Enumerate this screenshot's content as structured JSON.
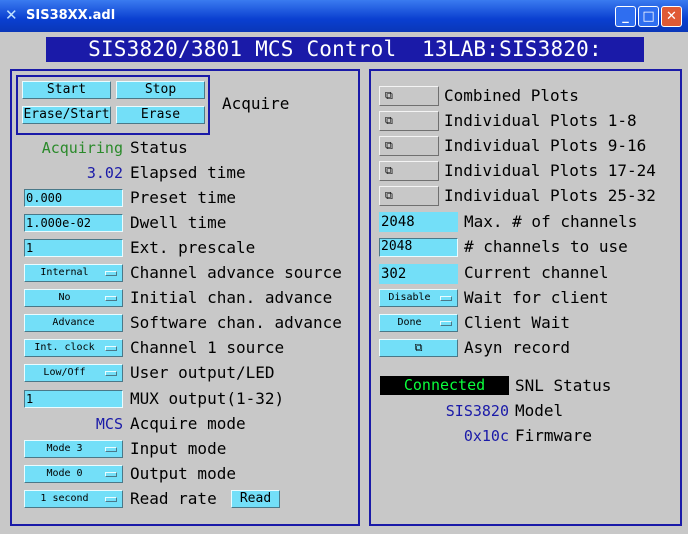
{
  "window": {
    "title": "SIS38XX.adl",
    "icon": "x-tool-icon",
    "btn_min": "_",
    "btn_max": "□",
    "btn_close": "✕"
  },
  "banner": "SIS3820/3801 MCS Control  13LAB:SIS3820:",
  "acquire": {
    "start": "Start",
    "stop": "Stop",
    "erase_start": "Erase/Start",
    "erase": "Erase",
    "label": "Acquire"
  },
  "left": {
    "status_value": "Acquiring",
    "status_color": "#2a8a2a",
    "status_label": "Status",
    "elapsed_value": "3.02",
    "elapsed_label": "Elapsed time",
    "preset_value": "0.000",
    "preset_label": "Preset time",
    "dwell_value": "1.000e-02",
    "dwell_label": "Dwell time",
    "prescale_value": "1",
    "prescale_label": "Ext. prescale",
    "chan_adv_src": "Internal",
    "chan_adv_src_label": "Channel advance source",
    "init_adv": "No",
    "init_adv_label": "Initial chan. advance",
    "soft_adv": "Advance",
    "soft_adv_label": "Software chan. advance",
    "ch1_src": "Int. clock",
    "ch1_src_label": "Channel 1 source",
    "user_out": "Low/Off",
    "user_out_label": "User output/LED",
    "mux_value": "1",
    "mux_label": "MUX output(1-32)",
    "acq_mode_value": "MCS",
    "acq_mode_label": "Acquire mode",
    "input_mode": "Mode 3",
    "input_mode_label": "Input mode",
    "output_mode": "Mode 0",
    "output_mode_label": "Output mode",
    "read_rate": "1 second",
    "read_rate_label": "Read rate",
    "read_btn": "Read"
  },
  "right": {
    "plots": [
      "Combined Plots",
      "Individual Plots 1-8",
      "Individual Plots 9-16",
      "Individual Plots 17-24",
      "Individual Plots 25-32"
    ],
    "max_channels_value": "2048",
    "max_channels_label": "Max. # of channels",
    "use_channels_value": "2048",
    "use_channels_label": "# channels to use",
    "current_channel_value": "302",
    "current_channel_label": "Current channel",
    "wait_client": "Disable",
    "wait_client_label": "Wait for client",
    "client_wait": "Done",
    "client_wait_label": "Client Wait",
    "asyn_label": "Asyn record",
    "snl_value": "Connected",
    "snl_label": "SNL Status",
    "model_value": "SIS3820",
    "model_label": "Model",
    "firmware_value": "0x10c",
    "firmware_label": "Firmware",
    "value_color": "#1a1aa8"
  }
}
